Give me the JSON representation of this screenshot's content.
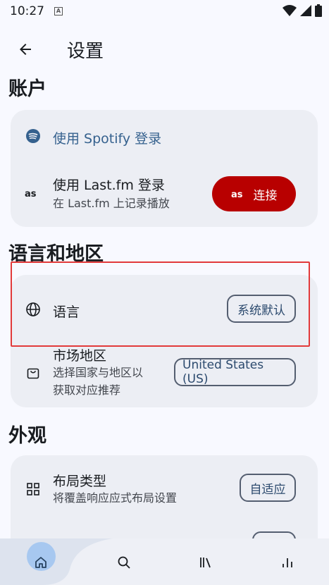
{
  "status": {
    "time": "10:27",
    "notification_icon": "A"
  },
  "header": {
    "title": "设置"
  },
  "sections": {
    "account": {
      "title": "账户",
      "spotify_label": "使用 Spotify 登录",
      "lastfm_title": "使用 Last.fm 登录",
      "lastfm_subtitle": "在 Last.fm 上记录播放",
      "lastfm_button": "连接"
    },
    "language_region": {
      "title": "语言和地区",
      "language_label": "语言",
      "language_value": "系统默认",
      "market_title": "市场地区",
      "market_subtitle_1": "选择国家与地区以",
      "market_subtitle_2": "获取对应推荐",
      "market_value": "United States (US)"
    },
    "appearance": {
      "title": "外观",
      "layout_title": "布局类型",
      "layout_subtitle": "将覆盖响应应式布局设置",
      "layout_value": "自适应"
    }
  },
  "colors": {
    "accent": "#35618e",
    "lastfm": "#b80000",
    "highlight": "#e23a3a"
  },
  "nav": [
    "home-icon",
    "search-icon",
    "library-icon",
    "stats-icon"
  ]
}
